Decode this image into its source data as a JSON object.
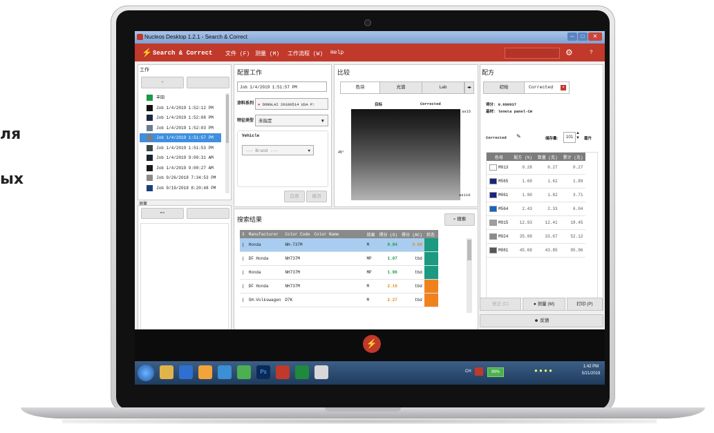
{
  "side_text": [
    "ля",
    "ых"
  ],
  "window": {
    "title": "Nucleos Desktop 1.2.1 - Search & Correct"
  },
  "menu": {
    "app_name": "Search & Correct",
    "items": [
      "文件 (F)",
      "测量 (M)",
      "工作流程 (W)",
      "Help"
    ],
    "help_icon": "?"
  },
  "jobs_panel": {
    "label": "工作",
    "add": "+",
    "jobs": [
      {
        "name": "丰田",
        "color": "#1a9a45"
      },
      {
        "name": "Job 1/4/2019 1:52:12 PM",
        "color": "#111111"
      },
      {
        "name": "Job 1/4/2019 1:52:08 PM",
        "color": "#1b2a44"
      },
      {
        "name": "Job 1/4/2019 1:52:03 PM",
        "color": "#6e7c8c"
      },
      {
        "name": "Job 1/4/2019 1:51:57 PM",
        "color": "#7a7e84",
        "selected": true
      },
      {
        "name": "Job 1/4/2019 1:51:53 PM",
        "color": "#3a4a44"
      },
      {
        "name": "Job 1/4/2019 9:00:31 AM",
        "color": "#1c2430"
      },
      {
        "name": "Job 1/4/2019 9:00:27 AM",
        "color": "#1a1a1a"
      },
      {
        "name": "Job 9/26/2018 7:34:53 PM",
        "color": "#8a8a8a"
      },
      {
        "name": "Job 9/19/2018 8:20:48 PM",
        "color": "#1c3f78"
      }
    ],
    "measure_label": "测量"
  },
  "config": {
    "title": "配置工作",
    "job_value": "Job 1/4/2019 1:51:57 PM",
    "series_label": "涂料系列",
    "series_value": "DONGLAI 20180514 USA P:",
    "variant_label": "特征类型",
    "variant_value": "未指定",
    "vehicle_label": "Vehicle",
    "brand_value": "--- Brand ---",
    "apply": "应用",
    "cancel": "撤消"
  },
  "compare": {
    "title": "比较",
    "tabs": [
      "色块",
      "光谱",
      "Lab"
    ],
    "target": "目标",
    "corrected": "Corrected",
    "angle_labels": [
      "as15",
      "45°",
      "as110"
    ]
  },
  "search": {
    "title": "搜索结果",
    "button": "搜索",
    "columns": [
      "3",
      "Manufacturer",
      "Color Code",
      "Color Name",
      "效果",
      "得分 (O)",
      "得分 (AC)",
      "状态"
    ],
    "rows": [
      {
        "idx": "(",
        "mfr": "Honda",
        "code": "NH-737M",
        "name": "",
        "effect": "M",
        "score": "0.94",
        "score_ac": "0.69",
        "status_color": "#1a9a80"
      },
      {
        "idx": "(",
        "mfr": "DF Honda",
        "code": "NH737M",
        "name": "",
        "effect": "MP",
        "score": "1.87",
        "score_ac": "tbd",
        "status_color": "#1a9a80"
      },
      {
        "idx": "(",
        "mfr": "Honda",
        "code": "NH737M",
        "name": "",
        "effect": "MP",
        "score": "1.96",
        "score_ac": "tbd",
        "status_color": "#1a9a80"
      },
      {
        "idx": "(",
        "mfr": "DF Honda",
        "code": "NH737M",
        "name": "",
        "effect": "M",
        "score": "2.16",
        "score_ac": "tbd",
        "status_color": "#f0821e"
      },
      {
        "idx": "(",
        "mfr": "SH-Volkswagen",
        "code": "D7K",
        "name": "",
        "effect": "M",
        "score": "2.27",
        "score_ac": "tbd",
        "status_color": "#f0821e"
      }
    ]
  },
  "formula": {
    "title": "配方",
    "tabs": [
      "初始",
      "Corrected"
    ],
    "score_label": "得分: 0.690937",
    "substrate_label": "基材: leneta panel-CW",
    "corrected_label": "Corrected",
    "volume_label": "储存量:",
    "volume_value": "101",
    "volume_unit": "毫升",
    "columns": [
      "色母",
      "配方 (%)",
      "数量 (克)",
      "累计 (克)"
    ],
    "rows": [
      {
        "name": "M013",
        "color": "#ffffff",
        "pct": "0.28",
        "qty": "0.27",
        "cum": "0.27"
      },
      {
        "name": "M565",
        "color": "#1a237e",
        "pct": "1.69",
        "qty": "1.62",
        "cum": "1.89"
      },
      {
        "name": "M061",
        "color": "#1a237e",
        "pct": "1.90",
        "qty": "1.82",
        "cum": "3.71"
      },
      {
        "name": "M564",
        "color": "#1565c0",
        "pct": "2.43",
        "qty": "2.33",
        "cum": "6.04"
      },
      {
        "name": "M915",
        "color": "#9e9e9e",
        "pct": "12.93",
        "qty": "12.41",
        "cum": "18.45"
      },
      {
        "name": "M924",
        "color": "#8a8a8a",
        "pct": "35.09",
        "qty": "33.67",
        "cum": "52.12"
      },
      {
        "name": "M881",
        "color": "#555555",
        "pct": "45.69",
        "qty": "43.85",
        "cum": "95.96"
      }
    ],
    "fix": "修正 (C)",
    "measure": "测量 (M)",
    "print": "打印 (P)",
    "feedback": "反馈"
  },
  "taskbar": {
    "battery": "99%",
    "time": "1:42 PM",
    "date": "5/21/2019",
    "lang": "CH"
  }
}
